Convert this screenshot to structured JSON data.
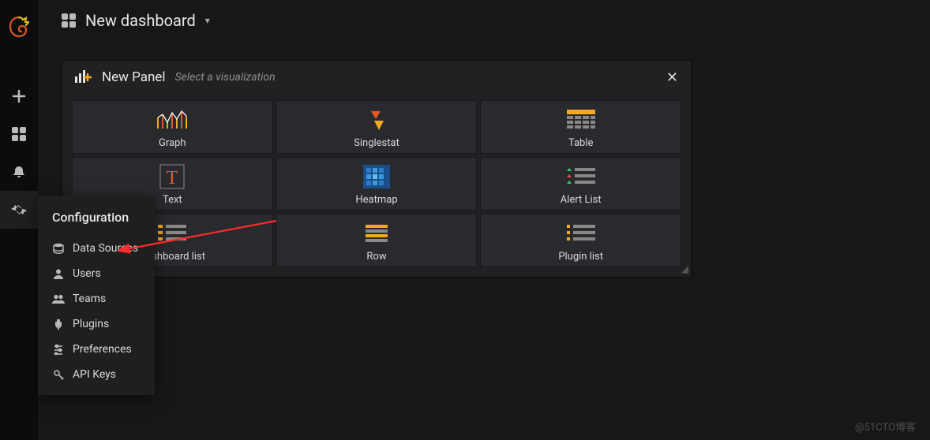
{
  "topbar": {
    "title": "New dashboard"
  },
  "panel": {
    "title": "New Panel",
    "subtitle": "Select a visualization",
    "tiles": [
      {
        "label": "Graph"
      },
      {
        "label": "Singlestat"
      },
      {
        "label": "Table"
      },
      {
        "label": "Text"
      },
      {
        "label": "Heatmap"
      },
      {
        "label": "Alert List"
      },
      {
        "label": "Dashboard list"
      },
      {
        "label": "Row"
      },
      {
        "label": "Plugin list"
      }
    ]
  },
  "config": {
    "header": "Configuration",
    "items": [
      {
        "label": "Data Sources",
        "icon": "database-icon"
      },
      {
        "label": "Users",
        "icon": "user-icon"
      },
      {
        "label": "Teams",
        "icon": "users-icon"
      },
      {
        "label": "Plugins",
        "icon": "plug-icon"
      },
      {
        "label": "Preferences",
        "icon": "sliders-icon"
      },
      {
        "label": "API Keys",
        "icon": "key-icon"
      }
    ]
  },
  "watermark": "@51CTO博客"
}
